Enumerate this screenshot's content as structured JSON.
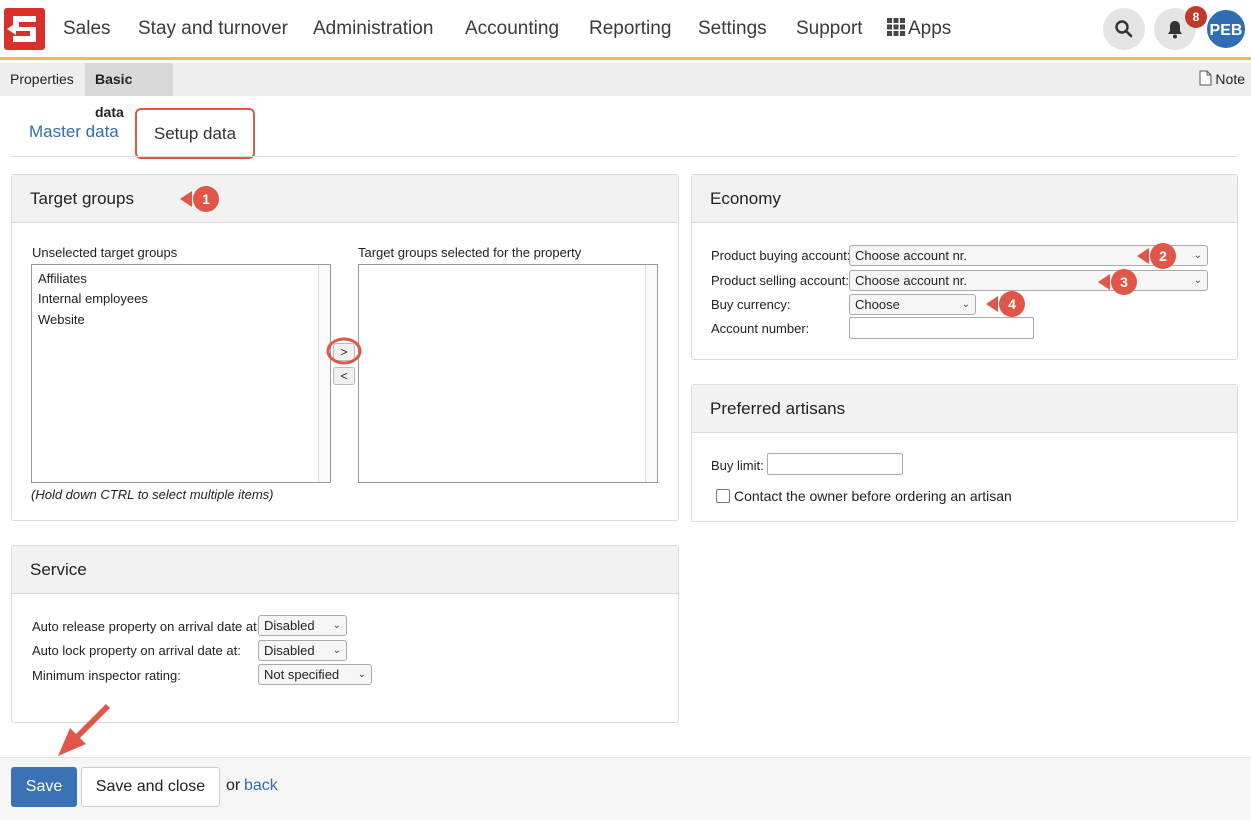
{
  "nav": {
    "items": [
      "Sales",
      "Stay and turnover",
      "Administration",
      "Accounting",
      "Reporting",
      "Settings",
      "Support"
    ],
    "apps_label": "Apps",
    "notification_count": "8",
    "avatar_initials": "PEB"
  },
  "subnav": {
    "tabs": [
      "Properties",
      "Basic data"
    ],
    "note_label": "Note"
  },
  "tabs": {
    "master": "Master data",
    "setup": "Setup data"
  },
  "target_groups": {
    "title": "Target groups",
    "unselected_label": "Unselected target groups",
    "selected_label": "Target groups selected for the property",
    "unselected_items": [
      "Affiliates",
      "Internal employees",
      "Website"
    ],
    "move_right": ">",
    "move_left": "<",
    "hint": "(Hold down CTRL to select multiple items)"
  },
  "economy": {
    "title": "Economy",
    "buying_label": "Product buying account:",
    "buying_value": "Choose account nr.",
    "selling_label": "Product selling account:",
    "selling_value": "Choose account nr.",
    "currency_label": "Buy currency:",
    "currency_value": "Choose",
    "account_label": "Account number:"
  },
  "artisans": {
    "title": "Preferred artisans",
    "buy_limit_label": "Buy limit:",
    "contact_label": "Contact the owner before ordering an artisan"
  },
  "service": {
    "title": "Service",
    "auto_release_label": "Auto release property on arrival date at:",
    "auto_release_value": "Disabled",
    "auto_lock_label": "Auto lock property on arrival date at:",
    "auto_lock_value": "Disabled",
    "min_rating_label": "Minimum inspector rating:",
    "min_rating_value": "Not specified"
  },
  "footer": {
    "save": "Save",
    "save_close": "Save and close",
    "or": "or",
    "back": "back"
  },
  "markers": [
    "1",
    "2",
    "3",
    "4"
  ],
  "colors": {
    "accent": "#2f6db5",
    "marker": "#e0574a",
    "logo": "#d9302a",
    "nav_underline": "#f0b84f"
  }
}
